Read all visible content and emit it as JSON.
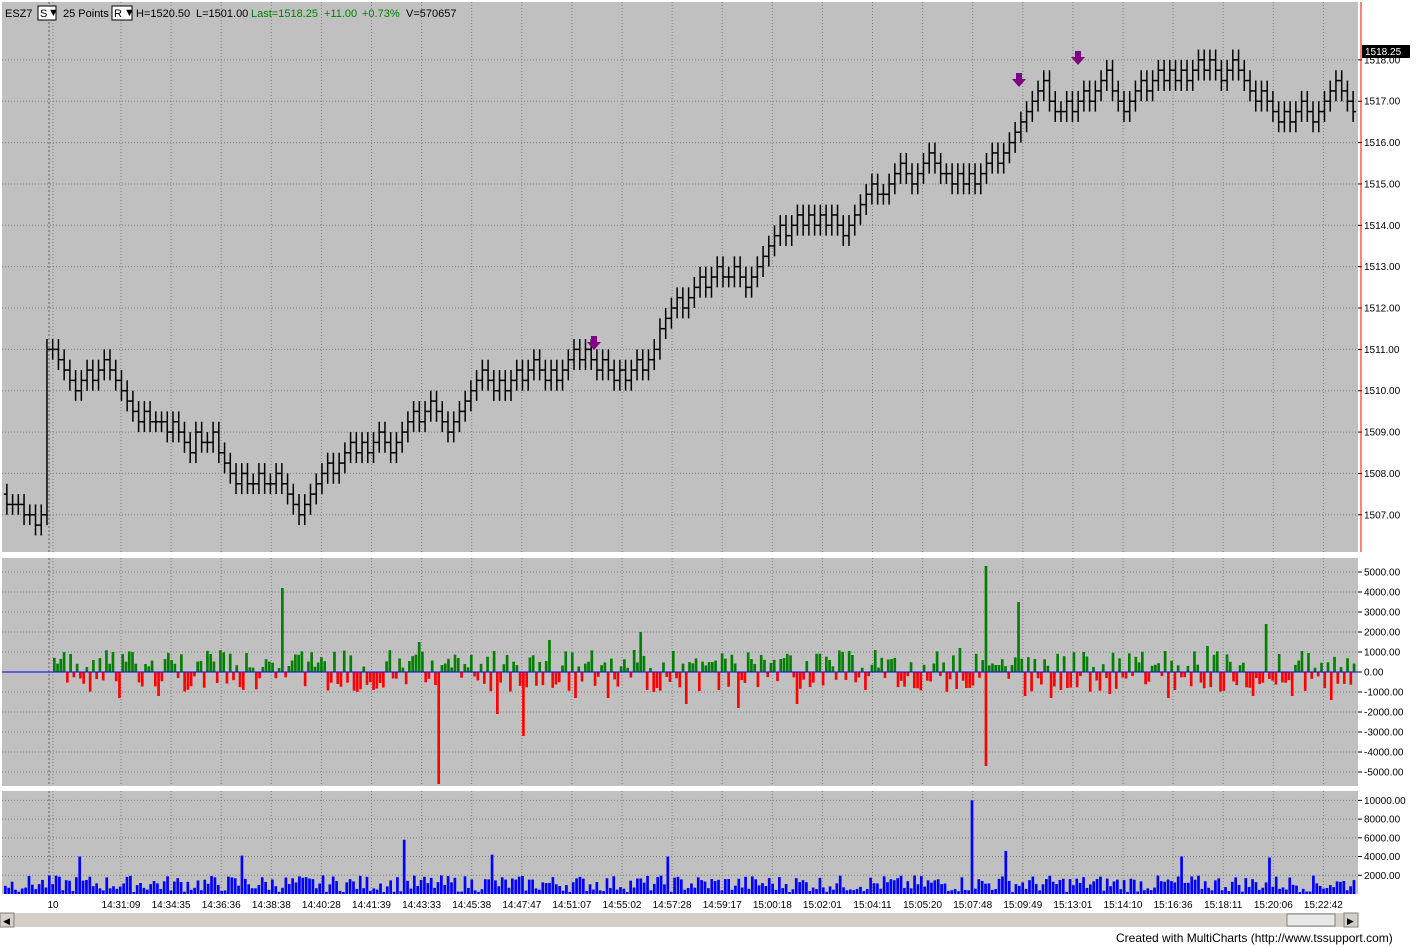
{
  "header": {
    "symbol": "ESZ7",
    "series_btn": "S",
    "bar_type": "25 Points",
    "range_btn": "R",
    "high": "H=1520.50",
    "low": "L=1501.00",
    "last": "Last=1518.25",
    "change": "+11.00",
    "change_pct": "+0.73%",
    "volume": "V=570657"
  },
  "price_marker": "1518.25",
  "footer": "Created with MultiCharts (http://www.tssupport.com)",
  "colors": {
    "plot_bg": "#c0c0c0",
    "bar": "#000000",
    "up": "#008000",
    "down": "#ff0000",
    "volume": "#0000ff",
    "arrow": "#800080",
    "zero_line": "#0000ff",
    "header_green": "#008000"
  },
  "chart_data": [
    {
      "type": "bar",
      "name": "price",
      "ylim": [
        1506.1,
        1519.4
      ],
      "y_ticks": [
        1507,
        1508,
        1509,
        1510,
        1511,
        1512,
        1513,
        1514,
        1515,
        1516,
        1517,
        1518
      ],
      "y_tick_labels": [
        "1507.00",
        "1508.00",
        "1509.00",
        "1510.00",
        "1511.00",
        "1512.00",
        "1513.00",
        "1514.00",
        "1515.00",
        "1516.00",
        "1517.00",
        "1518.00"
      ],
      "x_labels": [
        "10",
        "14:31:09",
        "14:34:35",
        "14:36:36",
        "14:38:38",
        "14:40:28",
        "14:41:39",
        "14:43:33",
        "14:45:38",
        "14:47:47",
        "14:51:07",
        "14:55:02",
        "14:57:28",
        "14:59:17",
        "15:00:18",
        "15:02:01",
        "15:04:11",
        "15:05:20",
        "15:07:48",
        "15:09:49",
        "15:13:01",
        "15:14:10",
        "15:16:36",
        "15:18:11",
        "15:20:06",
        "15:22:42"
      ],
      "closes": [
        1507.25,
        1507.25,
        1507.25,
        1507.0,
        1507.0,
        1506.75,
        1507.0,
        1511.0,
        1511.0,
        1510.75,
        1510.5,
        1510.25,
        1510.0,
        1510.25,
        1510.5,
        1510.25,
        1510.5,
        1510.75,
        1510.5,
        1510.25,
        1510.0,
        1509.75,
        1509.5,
        1509.25,
        1509.5,
        1509.25,
        1509.25,
        1509.25,
        1509.0,
        1509.25,
        1509.0,
        1508.75,
        1508.5,
        1509.0,
        1508.75,
        1508.75,
        1509.0,
        1508.5,
        1508.25,
        1508.0,
        1507.75,
        1508.0,
        1507.75,
        1507.75,
        1508.0,
        1507.75,
        1507.75,
        1508.0,
        1507.75,
        1507.5,
        1507.25,
        1507.0,
        1507.25,
        1507.5,
        1507.75,
        1508.0,
        1508.25,
        1508.0,
        1508.25,
        1508.5,
        1508.75,
        1508.5,
        1508.75,
        1508.5,
        1508.75,
        1509.0,
        1508.75,
        1508.5,
        1508.75,
        1509.0,
        1509.25,
        1509.5,
        1509.25,
        1509.5,
        1509.75,
        1509.5,
        1509.25,
        1509.0,
        1509.25,
        1509.5,
        1509.75,
        1510.0,
        1510.25,
        1510.5,
        1510.25,
        1510.0,
        1510.25,
        1510.0,
        1510.25,
        1510.5,
        1510.25,
        1510.5,
        1510.75,
        1510.5,
        1510.25,
        1510.5,
        1510.25,
        1510.5,
        1510.75,
        1511.0,
        1510.75,
        1511.0,
        1510.75,
        1510.5,
        1510.75,
        1510.5,
        1510.25,
        1510.5,
        1510.25,
        1510.5,
        1510.75,
        1510.5,
        1510.75,
        1511.0,
        1511.5,
        1511.75,
        1512.0,
        1512.25,
        1512.0,
        1512.25,
        1512.5,
        1512.75,
        1512.5,
        1512.75,
        1513.0,
        1512.75,
        1512.75,
        1513.0,
        1512.75,
        1512.5,
        1512.75,
        1513.0,
        1513.25,
        1513.5,
        1513.75,
        1514.0,
        1513.75,
        1514.0,
        1514.25,
        1514.0,
        1514.25,
        1514.0,
        1514.25,
        1514.0,
        1514.25,
        1514.0,
        1513.75,
        1514.0,
        1514.25,
        1514.5,
        1514.75,
        1515.0,
        1514.75,
        1514.75,
        1515.0,
        1515.25,
        1515.5,
        1515.25,
        1515.0,
        1515.25,
        1515.5,
        1515.75,
        1515.5,
        1515.25,
        1515.25,
        1515.0,
        1515.25,
        1515.0,
        1515.25,
        1515.0,
        1515.25,
        1515.5,
        1515.75,
        1515.5,
        1515.75,
        1516.0,
        1516.25,
        1516.5,
        1516.75,
        1517.0,
        1517.25,
        1517.5,
        1517.0,
        1516.75,
        1516.75,
        1517.0,
        1516.75,
        1517.0,
        1517.25,
        1517.0,
        1517.25,
        1517.5,
        1517.75,
        1517.25,
        1517.0,
        1516.75,
        1517.0,
        1517.25,
        1517.5,
        1517.25,
        1517.5,
        1517.75,
        1517.5,
        1517.75,
        1517.5,
        1517.75,
        1517.5,
        1517.75,
        1518.0,
        1517.75,
        1518.0,
        1517.75,
        1517.5,
        1517.75,
        1518.0,
        1517.75,
        1517.5,
        1517.25,
        1517.0,
        1517.25,
        1517.0,
        1516.75,
        1516.5,
        1516.75,
        1516.5,
        1516.75,
        1517.0,
        1516.75,
        1516.5,
        1516.75,
        1517.0,
        1517.25,
        1517.5,
        1517.25,
        1517.0,
        1516.75
      ]
    },
    {
      "type": "bar",
      "name": "delta",
      "ylim": [
        -5700,
        5700
      ],
      "y_ticks": [
        -5000,
        -4000,
        -3000,
        -2000,
        -1000,
        0,
        1000,
        2000,
        3000,
        4000,
        5000
      ],
      "y_tick_labels": [
        "-5000.00",
        "-4000.00",
        "-3000.00",
        "-2000.00",
        "-1000.00",
        "0.00",
        "1000.00",
        "2000.00",
        "3000.00",
        "4000.00",
        "5000.00"
      ],
      "spikes": [
        [
          18,
          1000
        ],
        [
          20,
          -1300
        ],
        [
          32,
          -1200
        ],
        [
          48,
          900
        ],
        [
          70,
          4200
        ],
        [
          98,
          -900
        ],
        [
          112,
          1500
        ],
        [
          118,
          -5600
        ],
        [
          136,
          -2100
        ],
        [
          144,
          -3200
        ],
        [
          152,
          1600
        ],
        [
          160,
          -1300
        ],
        [
          170,
          -1300
        ],
        [
          178,
          1100
        ],
        [
          180,
          2000
        ],
        [
          194,
          -1600
        ],
        [
          204,
          -900
        ],
        [
          210,
          -1800
        ],
        [
          228,
          -1600
        ],
        [
          242,
          1000
        ],
        [
          278,
          1200
        ],
        [
          286,
          -4700
        ],
        [
          286,
          5300
        ],
        [
          296,
          3500
        ],
        [
          298,
          -1200
        ],
        [
          306,
          -1300
        ],
        [
          316,
          1000
        ],
        [
          324,
          -1100
        ],
        [
          342,
          -1300
        ],
        [
          354,
          1300
        ],
        [
          368,
          -1200
        ],
        [
          372,
          2400
        ],
        [
          380,
          -1200
        ],
        [
          392,
          -1400
        ]
      ]
    },
    {
      "type": "bar",
      "name": "volume",
      "ylim": [
        0,
        11000
      ],
      "y_ticks": [
        2000,
        4000,
        6000,
        8000,
        10000
      ],
      "y_tick_labels": [
        "2000.00",
        "4000.00",
        "6000.00",
        "8000.00",
        "10000.00"
      ],
      "spikes": [
        [
          22,
          4000
        ],
        [
          70,
          4100
        ],
        [
          118,
          5800
        ],
        [
          144,
          4200
        ],
        [
          196,
          4000
        ],
        [
          286,
          10000
        ],
        [
          296,
          4600
        ],
        [
          348,
          4000
        ],
        [
          374,
          3900
        ]
      ]
    }
  ]
}
